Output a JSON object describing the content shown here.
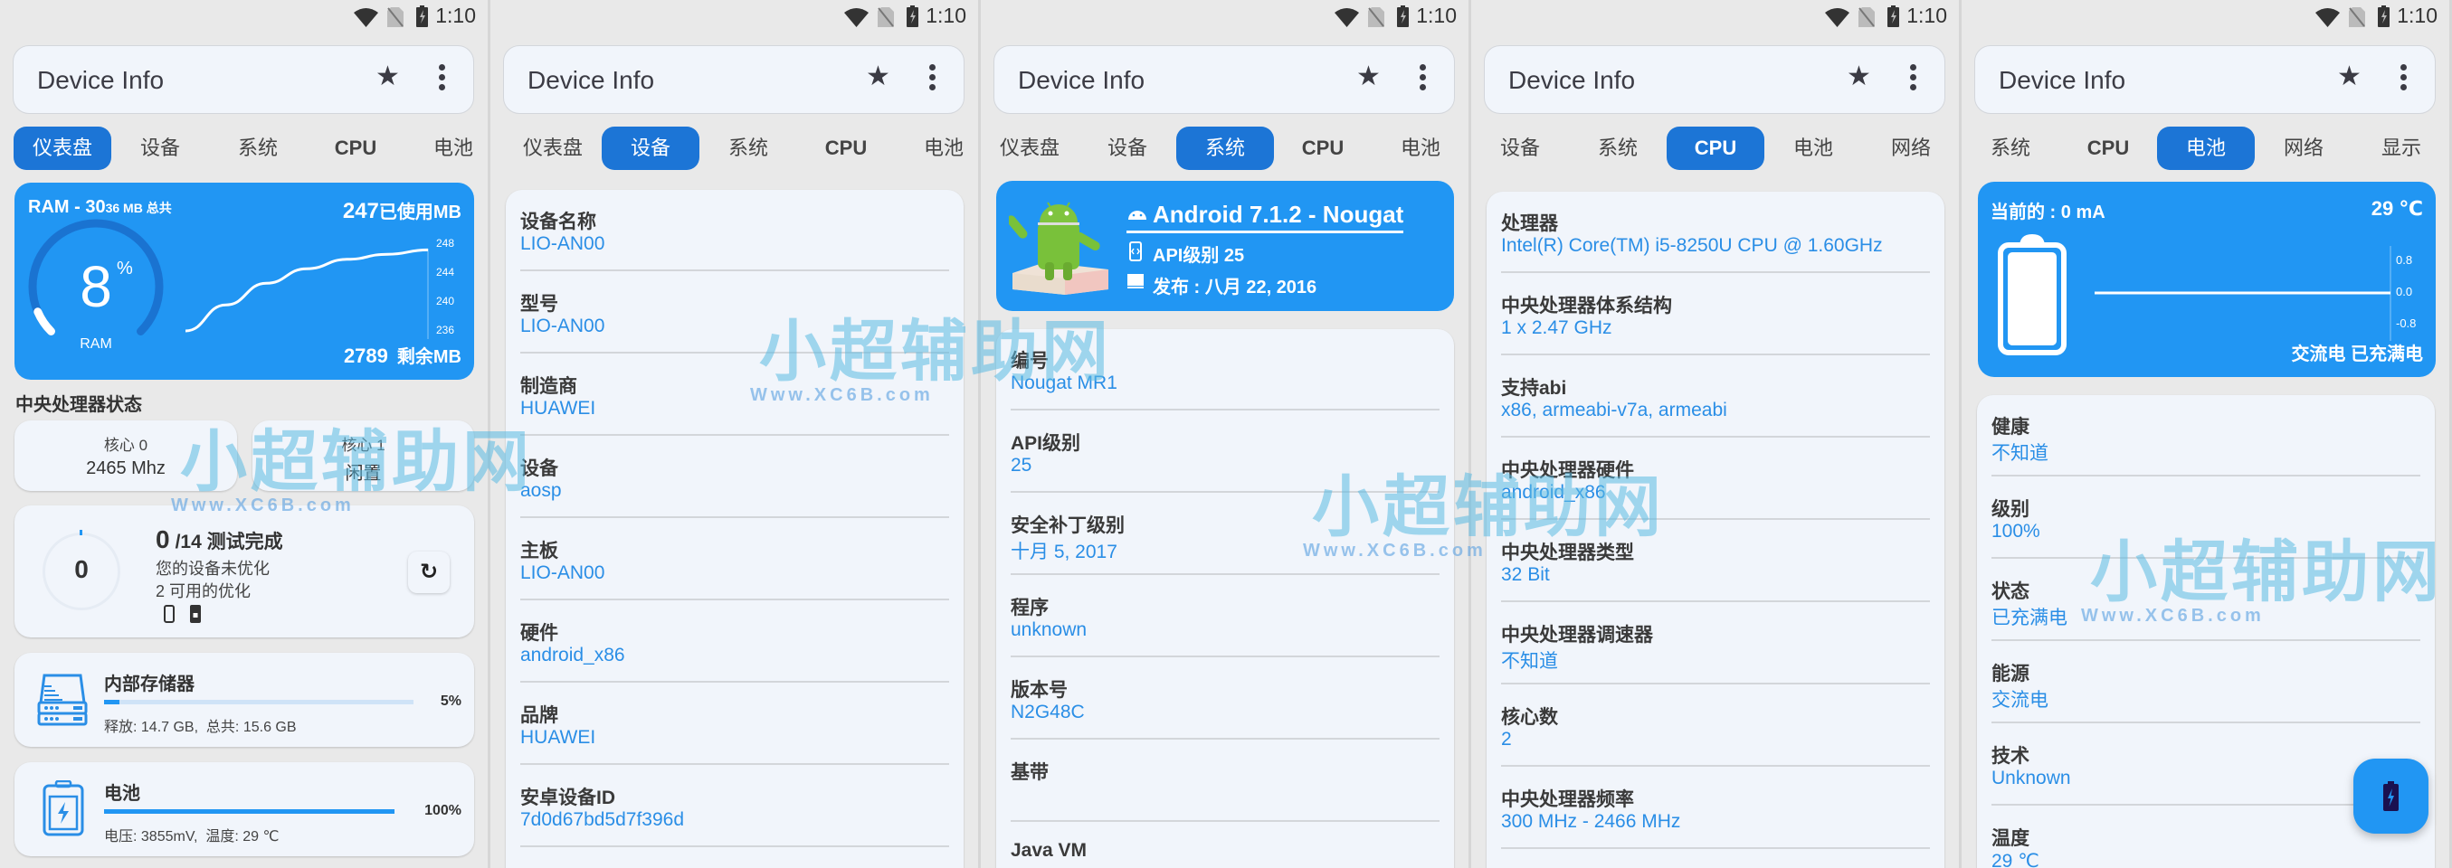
{
  "status_bar": {
    "time": "1:10",
    "icons": [
      "wifi-icon",
      "no-sim-icon",
      "battery-charging-icon"
    ]
  },
  "app_bar": {
    "title": "Device Info",
    "star_icon": "star-icon",
    "more_icon": "more-vert-icon"
  },
  "colors": {
    "accent": "#2196f3",
    "tab_active": "#1c75d6",
    "value_text": "#2a8ee6",
    "background": "#e8e8e8",
    "card": "#f1f5fb"
  },
  "panels": [
    {
      "id": "dashboard",
      "tabs": [
        {
          "label": "仪表盘",
          "active": true
        },
        {
          "label": "设备"
        },
        {
          "label": "系统"
        },
        {
          "label": "CPU"
        },
        {
          "label": "电池"
        }
      ]
    },
    {
      "id": "device",
      "tabs": [
        {
          "label": "仪表盘"
        },
        {
          "label": "设备",
          "active": true
        },
        {
          "label": "系统"
        },
        {
          "label": "CPU"
        },
        {
          "label": "电池"
        }
      ],
      "rows": [
        {
          "label": "设备名称",
          "value": "LIO-AN00"
        },
        {
          "label": "型号",
          "value": "LIO-AN00"
        },
        {
          "label": "制造商",
          "value": "HUAWEI"
        },
        {
          "label": "设备",
          "value": "aosp"
        },
        {
          "label": "主板",
          "value": "LIO-AN00"
        },
        {
          "label": "硬件",
          "value": "android_x86"
        },
        {
          "label": "品牌",
          "value": "HUAWEI"
        },
        {
          "label": "安卓设备ID",
          "value": "7d0d67bd5d7f396d"
        }
      ]
    },
    {
      "id": "system",
      "tabs": [
        {
          "label": "仪表盘"
        },
        {
          "label": "设备"
        },
        {
          "label": "系统",
          "active": true
        },
        {
          "label": "CPU"
        },
        {
          "label": "电池"
        }
      ],
      "hero": {
        "title": "Android 7.1.2 - Nougat",
        "api": "API级别 25",
        "release": "发布 : 八月 22, 2016"
      },
      "rows": [
        {
          "label": "编号",
          "value": "Nougat MR1"
        },
        {
          "label": "API级别",
          "value": "25"
        },
        {
          "label": "安全补丁级别",
          "value": "十月 5, 2017"
        },
        {
          "label": "程序",
          "value": "unknown"
        },
        {
          "label": "版本号",
          "value": "N2G48C"
        },
        {
          "label": "基带",
          "value": ""
        },
        {
          "label": "Java VM",
          "value": ""
        }
      ]
    },
    {
      "id": "cpu",
      "tabs": [
        {
          "label": "设备"
        },
        {
          "label": "系统"
        },
        {
          "label": "CPU",
          "active": true
        },
        {
          "label": "电池"
        },
        {
          "label": "网络"
        }
      ],
      "rows": [
        {
          "label": "处理器",
          "value": "Intel(R) Core(TM) i5-8250U CPU @ 1.60GHz"
        },
        {
          "label": "中央处理器体系结构",
          "value": "1 x 2.47 GHz"
        },
        {
          "label": "支持abi",
          "value": "x86, armeabi-v7a, armeabi"
        },
        {
          "label": "中央处理器硬件",
          "value": "android_x86"
        },
        {
          "label": "中央处理器类型",
          "value": "32 Bit"
        },
        {
          "label": "中央处理器调速器",
          "value": "不知道"
        },
        {
          "label": "核心数",
          "value": "2"
        },
        {
          "label": "中央处理器频率",
          "value": "300 MHz - 2466 MHz"
        }
      ]
    },
    {
      "id": "battery",
      "tabs": [
        {
          "label": "系统"
        },
        {
          "label": "CPU"
        },
        {
          "label": "电池",
          "active": true
        },
        {
          "label": "网络"
        },
        {
          "label": "显示"
        }
      ],
      "hero": {
        "current": "当前的 : 0 mA",
        "temperature": "29 ℃",
        "status": "交流电 已充满电",
        "chart": {
          "type": "line",
          "y_ticks": [
            "0.8",
            "0.0",
            "-0.8"
          ],
          "ylim": [
            -0.8,
            0.8
          ],
          "values": [
            0,
            0
          ]
        }
      },
      "rows": [
        {
          "label": "健康",
          "value": "不知道"
        },
        {
          "label": "级别",
          "value": "100%"
        },
        {
          "label": "状态",
          "value": "已充满电"
        },
        {
          "label": "能源",
          "value": "交流电"
        },
        {
          "label": "技术",
          "value": "Unknown"
        },
        {
          "label": "温度",
          "value": "29 ℃"
        }
      ],
      "fab_icon": "battery-charging-icon"
    }
  ],
  "dashboard": {
    "ram": {
      "title_main": "RAM - 30",
      "title_small": "36 MB 总共",
      "used_value": "247",
      "used_unit": "已使用MB",
      "free_value": "2789",
      "free_unit": "剩余MB",
      "percent": "8",
      "percent_sign": "%",
      "gauge_label": "RAM",
      "gauge_fraction": 0.08,
      "chart": {
        "type": "line",
        "y_ticks": [
          "248",
          "244",
          "240",
          "236"
        ],
        "ylim": [
          236,
          248
        ],
        "values": [
          236,
          239.6,
          242.6,
          244.6,
          245.9,
          246.6,
          247.2
        ]
      }
    },
    "cpu_status_heading": "中央处理器状态",
    "cores": [
      {
        "name": "核心 0",
        "value": "2465 Mhz"
      },
      {
        "name": "核心 1",
        "value": "闲置"
      }
    ],
    "optimization": {
      "score": "0",
      "done": "0",
      "total_label": "/14 测试完成",
      "line1": "您的设备未优化",
      "line2": "2 可用的优化",
      "progress_fraction": 0
    },
    "storage": {
      "title": "内部存储器",
      "percent_label": "5%",
      "fraction": 0.05,
      "detail": "释放: 14.7 GB,  总共: 15.6 GB"
    },
    "battery": {
      "title": "电池",
      "percent_label": "100%",
      "fraction": 1.0,
      "detail": "电压: 3855mV,  温度: 29 ℃"
    }
  },
  "watermark": {
    "text": "小超辅助网",
    "url": "Www.XC6B.com"
  }
}
